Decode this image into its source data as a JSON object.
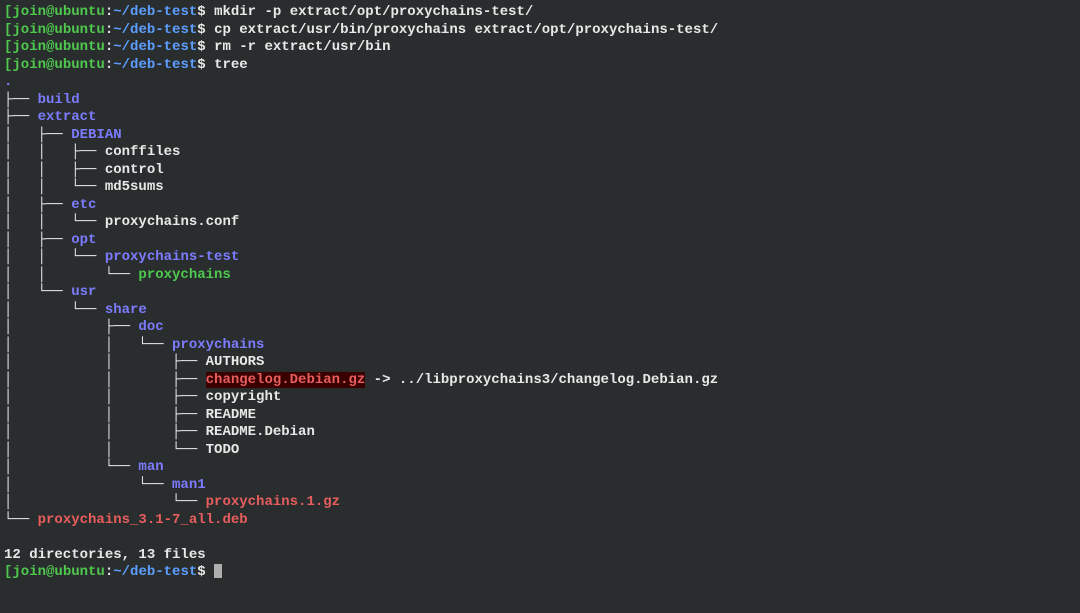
{
  "prompt": {
    "user": "join",
    "at": "@",
    "host": "ubuntu",
    "colon": ":",
    "path": "~/deb-test",
    "dollar": "$ "
  },
  "commands": {
    "cmd1": "mkdir -p extract/opt/proxychains-test/",
    "cmd2": "cp extract/usr/bin/proxychains extract/opt/proxychains-test/",
    "cmd3": "rm -r extract/usr/bin",
    "cmd4": "tree"
  },
  "tree": {
    "root": ".",
    "l0a": "├── ",
    "l0b": "│   ",
    "l0c": "└── ",
    "build": "build",
    "extract": "extract",
    "debian": "DEBIAN",
    "conffiles": "conffiles",
    "control": "control",
    "md5sums": "md5sums",
    "etc": "etc",
    "pxconf": "proxychains.conf",
    "opt": "opt",
    "pxtest": "proxychains-test",
    "px": "proxychains",
    "usr": "usr",
    "share": "share",
    "doc": "doc",
    "authors": "AUTHORS",
    "changelog": "changelog.Debian.gz",
    "arrow": " -> ",
    "changelogTarget": "../libproxychains3/changelog.Debian.gz",
    "copyright": "copyright",
    "readme": "README",
    "readmeDeb": "README.Debian",
    "todo": "TODO",
    "man": "man",
    "man1": "man1",
    "man1gz": "proxychains.1.gz",
    "deb": "proxychains_3.1-7_all.deb"
  },
  "summary": "12 directories, 13 files",
  "pipes": {
    "p1": "├── ",
    "p2": "│   ├── ",
    "p3": "│   │   ├── ",
    "p4": "│   │   └── ",
    "p5": "│   ├── ",
    "p6": "│   │   └── ",
    "p7": "│   ├── ",
    "p8": "│   │   └── ",
    "p9": "│   │       └── ",
    "p10": "│   └── ",
    "p11": "│       └── ",
    "p12": "│           ├── ",
    "p13": "│           │   └── ",
    "p14": "│           │       ├── ",
    "p15": "│           │       └── ",
    "p16": "│           └── ",
    "p17": "│               └── ",
    "p18": "│                   └── ",
    "p19": "└── "
  }
}
